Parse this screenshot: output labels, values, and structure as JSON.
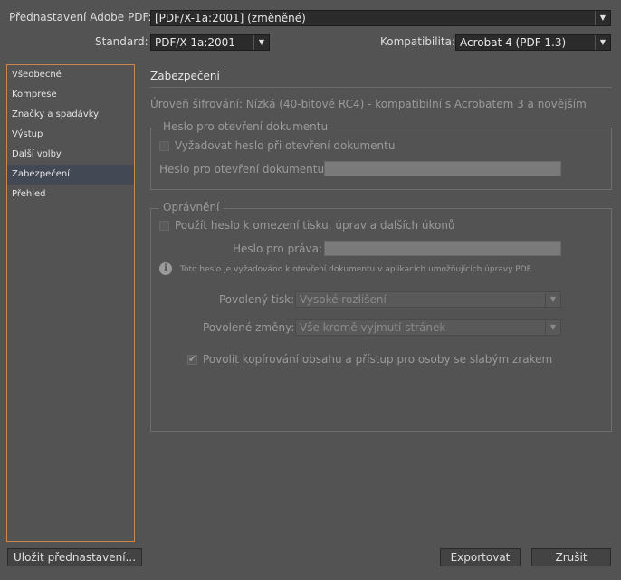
{
  "header": {
    "preset_label": "Přednastavení Adobe PDF:",
    "preset_value": "[PDF/X-1a:2001] (změněné)",
    "standard_label": "Standard:",
    "standard_value": "PDF/X-1a:2001",
    "compat_label": "Kompatibilita:",
    "compat_value": "Acrobat 4 (PDF 1.3)"
  },
  "sidebar": {
    "items": [
      {
        "label": "Všeobecné"
      },
      {
        "label": "Komprese"
      },
      {
        "label": "Značky a spadávky"
      },
      {
        "label": "Výstup"
      },
      {
        "label": "Další volby"
      },
      {
        "label": "Zabezpečení"
      },
      {
        "label": "Přehled"
      }
    ],
    "selected": "Zabezpečení"
  },
  "main": {
    "title": "Zabezpečení",
    "encryption_level": "Úroveň šifrování: Nízká (40-bitové RC4) - kompatibilní s Acrobatem 3 a novějším",
    "open_group": {
      "title": "Heslo pro otevření dokumentu",
      "require_checkbox": "Vyžadovat heslo při otevření dokumentu",
      "password_label": "Heslo pro otevření dokumentu:",
      "password_value": ""
    },
    "perm_group": {
      "title": "Oprávnění",
      "use_password_checkbox": "Použít heslo k omezení tisku, úprav a dalších úkonů",
      "rights_label": "Heslo pro práva:",
      "rights_value": "",
      "info_text": "Toto heslo je vyžadováno k otevření dokumentu v aplikacích umožňujících úpravy PDF.",
      "print_label": "Povolený tisk:",
      "print_value": "Vysoké rozlišení",
      "changes_label": "Povolené změny:",
      "changes_value": "Vše kromě vyjmutí stránek",
      "copy_checkbox": "Povolit kopírování obsahu a přístup pro osoby se slabým zrakem",
      "copy_checked": true
    }
  },
  "footer": {
    "save_preset": "Uložit přednastavení...",
    "export": "Exportovat",
    "cancel": "Zrušit"
  },
  "icons": {
    "dropdown": "chevron-down-icon",
    "info": "info-icon",
    "check": "check-icon"
  }
}
